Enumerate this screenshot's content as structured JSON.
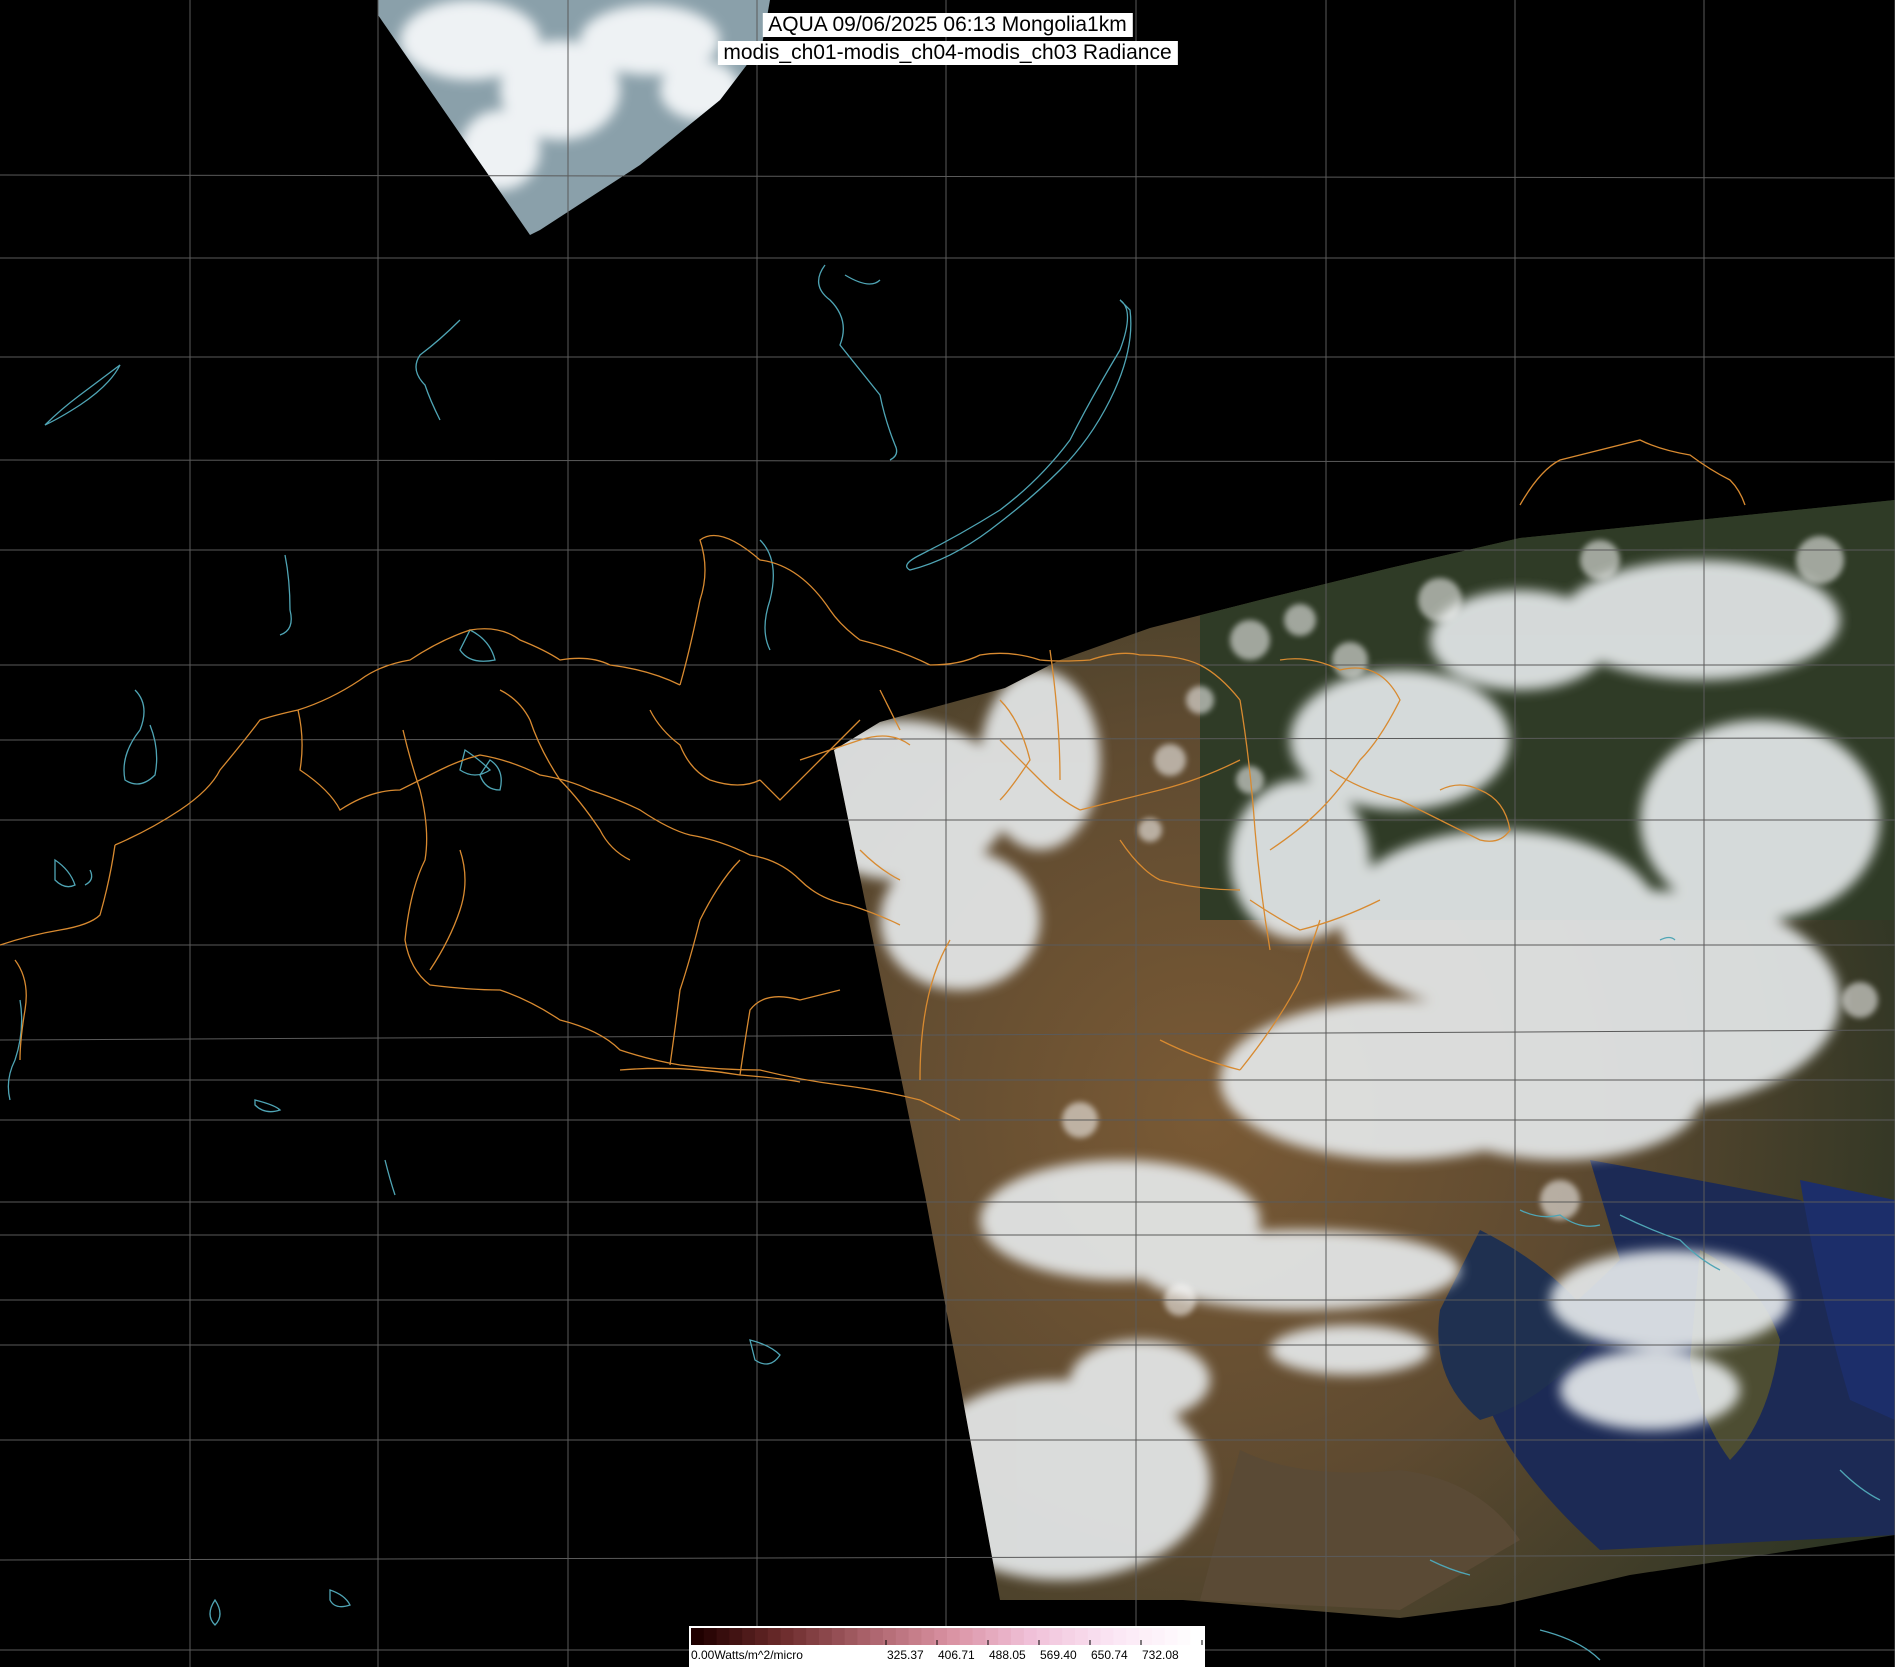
{
  "header": {
    "line1": "AQUA 09/06/2025 06:13 Mongolia1km",
    "line2": "modis_ch01-modis_ch04-modis_ch03 Radiance"
  },
  "colorbar": {
    "labels": [
      "0.00Watts/m^2/micro",
      "325.37",
      "406.71",
      "488.05",
      "569.40",
      "650.74",
      "732.08"
    ],
    "colors": [
      "#200000",
      "#6a2a2a",
      "#a86068",
      "#d890a0",
      "#f0c0d8",
      "#fbe6f4",
      "#ffffff"
    ]
  },
  "map_layers": {
    "background": "#000000",
    "grid_color": "#5a5a5a",
    "border_color": "#d88a30",
    "water_color": "#4fa5b5",
    "layers": [
      "graticule",
      "admin-borders",
      "lakes-and-coastlines",
      "satellite-swath-main",
      "satellite-swath-top"
    ]
  }
}
